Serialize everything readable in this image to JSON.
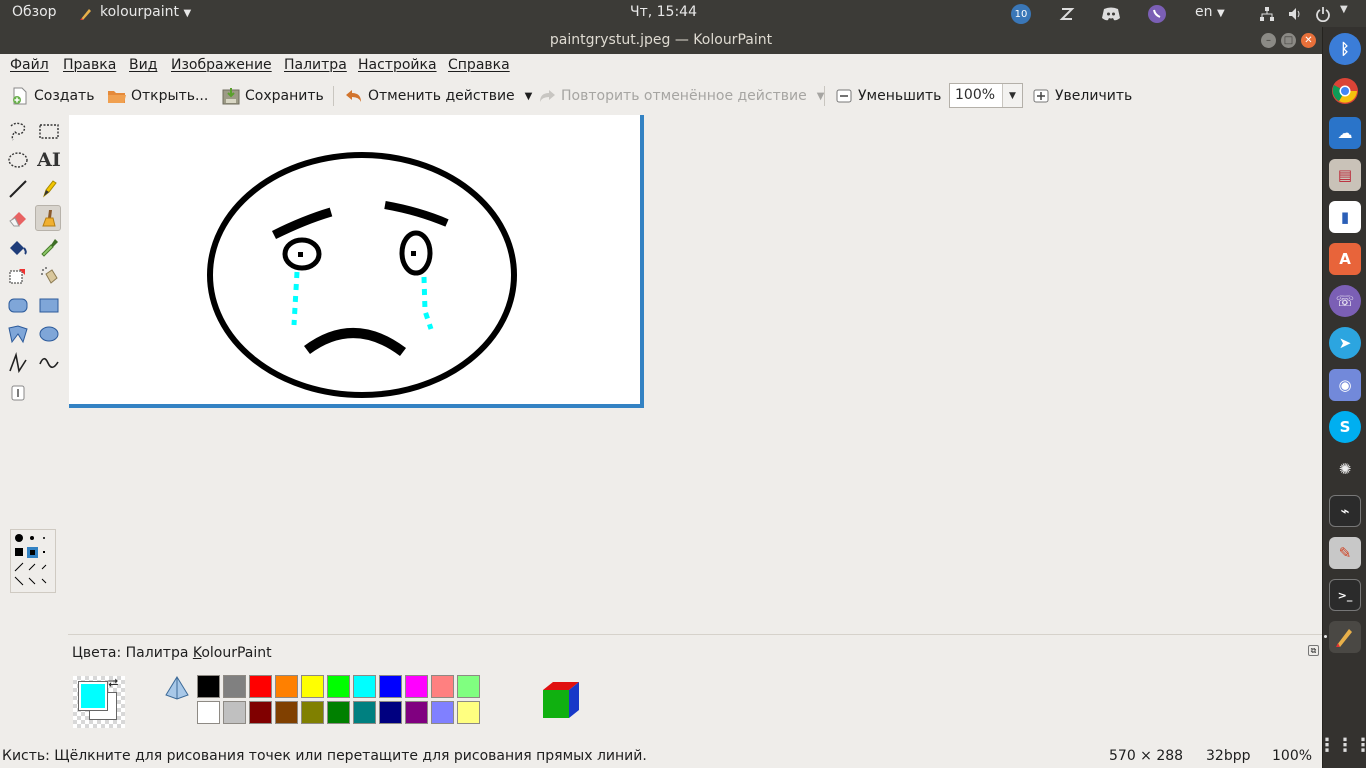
{
  "topbar": {
    "overview": "Обзор",
    "app_name": "kolourpaint",
    "clock": "Чт, 15:44",
    "badge_count": "10",
    "language": "en"
  },
  "window": {
    "title": "paintgrystut.jpeg  — KolourPaint"
  },
  "menu": {
    "file": "Файл",
    "edit": "Правка",
    "view": "Вид",
    "image": "Изображение",
    "palette": "Палитра",
    "settings": "Настройка",
    "help": "Справка"
  },
  "toolbar": {
    "new": "Создать",
    "open": "Открыть...",
    "save": "Сохранить",
    "undo": "Отменить действие",
    "redo": "Повторить отменённое действие",
    "zoom_out": "Уменьшить",
    "zoom_value": "100%",
    "zoom_in": "Увеличить"
  },
  "colors": {
    "caption_prefix": "Цвета: Палитра ",
    "caption_k": "K",
    "caption_rest": "olourPaint",
    "foreground": "#00ffff",
    "background": "#ffffff",
    "row1": [
      "#000000",
      "#808080",
      "#ff0000",
      "#ff8000",
      "#ffff00",
      "#00ff00",
      "#00ffff",
      "#0000ff",
      "#ff00ff",
      "#ff8080",
      "#80ff80"
    ],
    "row2": [
      "#ffffff",
      "#c0c0c0",
      "#800000",
      "#804000",
      "#808000",
      "#008000",
      "#008080",
      "#000080",
      "#800080",
      "#8080ff",
      "#ffff80"
    ]
  },
  "status": {
    "hint": "Кисть: Щёлкните для рисования точек или перетащите для рисования прямых линий.",
    "size": "570 × 288",
    "depth": "32bpp",
    "zoom": "100%"
  }
}
